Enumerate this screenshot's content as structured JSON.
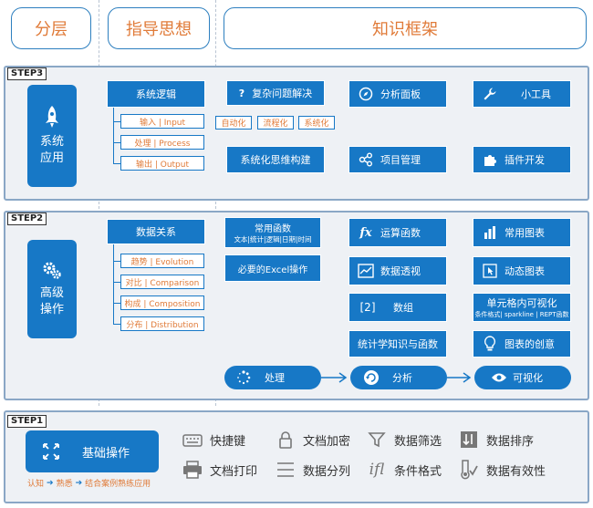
{
  "headers": {
    "layer": "分层",
    "guide": "指导思想",
    "framework": "知识框架"
  },
  "step3": {
    "tag": "STEP3",
    "main": [
      "系统",
      "应用"
    ],
    "logic": {
      "title": "系统逻辑",
      "items": [
        "输入 | Input",
        "处理 | Process",
        "输出 | Output"
      ]
    },
    "complex": {
      "title": "复杂问题解决",
      "icon": "?",
      "tags": [
        "自动化",
        "流程化",
        "系统化"
      ]
    },
    "thinking": "系统化思维构建",
    "dashboard": "分析面板",
    "project": "项目管理",
    "tools": "小工具",
    "plugin": "插件开发"
  },
  "step2": {
    "tag": "STEP2",
    "main": [
      "高级",
      "操作"
    ],
    "relation": {
      "title": "数据关系",
      "items": [
        "趋势 | Evolution",
        "对比 | Comparison",
        "构成 | Composition",
        "分布 | Distribution"
      ]
    },
    "functions": {
      "line1": "常用函数",
      "line2": "文本|统计|逻辑|日期|时间"
    },
    "excel_ops": "必要的Excel操作",
    "calc": "运算函数",
    "pivot": "数据透视",
    "array": "数组",
    "array_icon": "[2]",
    "stats": "统计学知识与函数",
    "charts": "常用图表",
    "dynamic": "动态图表",
    "cell_viz": {
      "line1": "单元格内可视化",
      "line2": "条件格式| sparkline | REPT函数"
    },
    "creative": "图表的创意",
    "flow": [
      "处理",
      "分析",
      "可视化"
    ]
  },
  "step1": {
    "tag": "STEP1",
    "main": "基础操作",
    "path": [
      "认知",
      "熟悉",
      "结合案例熟练应用"
    ],
    "tools": [
      "快捷键",
      "文档加密",
      "数据筛选",
      "数据排序",
      "文档打印",
      "数据分列",
      "条件格式",
      "数据有效性"
    ]
  },
  "colors": {
    "blue": "#1778c6",
    "orange": "#e07b39",
    "panel": "#eef1f5"
  }
}
